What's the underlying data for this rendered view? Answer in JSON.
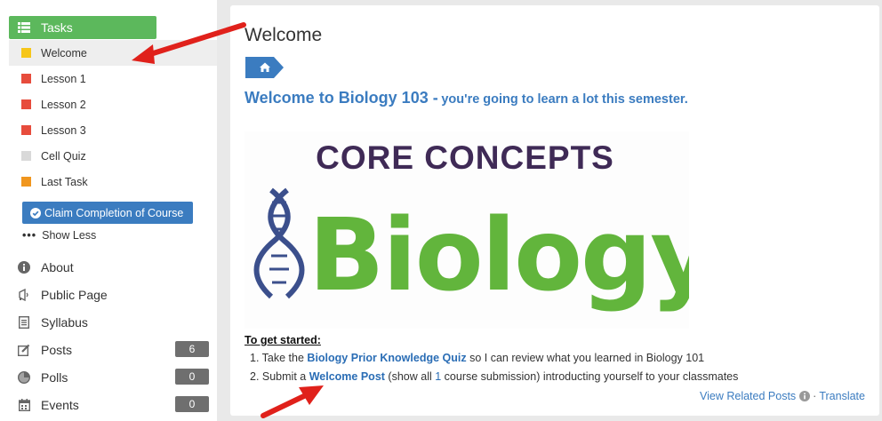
{
  "sidebar": {
    "tasks_label": "Tasks",
    "tasks": [
      {
        "label": "Welcome",
        "color": "#f6c61a",
        "active": true
      },
      {
        "label": "Lesson 1",
        "color": "#e74c3c",
        "active": false
      },
      {
        "label": "Lesson 2",
        "color": "#e74c3c",
        "active": false
      },
      {
        "label": "Lesson 3",
        "color": "#e74c3c",
        "active": false
      },
      {
        "label": "Cell Quiz",
        "color": "#d9d9d9",
        "active": false
      },
      {
        "label": "Last Task",
        "color": "#f0961e",
        "active": false
      }
    ],
    "claim_label": "Claim Completion of Course",
    "show_less": "Show Less",
    "nav": [
      {
        "label": "About",
        "icon": "info-icon",
        "badge": ""
      },
      {
        "label": "Public Page",
        "icon": "megaphone-icon",
        "badge": ""
      },
      {
        "label": "Syllabus",
        "icon": "document-icon",
        "badge": ""
      },
      {
        "label": "Posts",
        "icon": "edit-icon",
        "badge": "6"
      },
      {
        "label": "Polls",
        "icon": "pie-chart-icon",
        "badge": "0"
      },
      {
        "label": "Events",
        "icon": "calendar-icon",
        "badge": "0"
      }
    ]
  },
  "main": {
    "title": "Welcome",
    "headline_big": "Welcome to Biology 103 -",
    "headline_small": "you're going to learn a lot this semester.",
    "banner": {
      "line1": "CORE CONCEPTS",
      "line2": "Biology"
    },
    "get_started": "To get started:",
    "step1_prefix": "1. Take the",
    "step1_link": "Biology Prior Knowledge Quiz",
    "step1_suffix": "so I can review what you learned in Biology 101",
    "step2_prefix": "2. Submit a",
    "step2_link": "Welcome Post",
    "step2_middle_a": "(show all",
    "step2_count": "1",
    "step2_middle_b": "course submission) introducting yourself to your classmates",
    "view_related": "View Related Posts",
    "translate": "Translate"
  },
  "colors": {
    "tasks_green": "#5cb85c",
    "link_blue": "#3b7cc0",
    "banner_purple": "#3f2a56",
    "banner_green": "#62b53c",
    "arrow_red": "#e0211b"
  }
}
